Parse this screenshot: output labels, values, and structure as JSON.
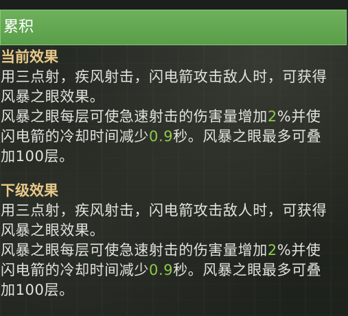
{
  "header": {
    "title": "累积",
    "color": "#5ea54c"
  },
  "sections": [
    {
      "title": "当前效果",
      "line1": "用三点射，疾风射击，闪电箭攻击敌人时，可获得",
      "line2": "风暴之眼效果。",
      "line3_pre": "风暴之眼每层可使急速射击的伤害量增加",
      "line3_num": "2",
      "line3_post": "%并使",
      "line4_pre": "闪电箭的冷却时间减少",
      "line4_num": "0.9",
      "line4_post": "秒。风暴之眼最多可叠",
      "line5": "加100层。"
    },
    {
      "title": "下级效果",
      "line1": "用三点射，疾风射击，闪电箭攻击敌人时，可获得",
      "line2": "风暴之眼效果。",
      "line3_pre": "风暴之眼每层可使急速射击的伤害量增加",
      "line3_num": "2",
      "line3_post": "%并使",
      "line4_pre": "闪电箭的冷却时间减少",
      "line4_num": "0.9",
      "line4_post": "秒。风暴之眼最多可叠",
      "line5": "加100层。"
    }
  ],
  "colors": {
    "section_title": "#e8c98a",
    "body_text": "#e2e2de",
    "highlight_number": "#8fca4a"
  }
}
